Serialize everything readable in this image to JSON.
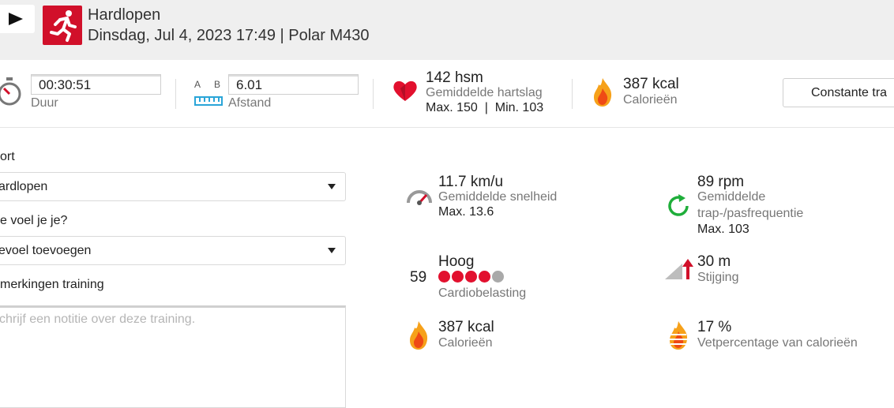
{
  "header": {
    "title": "Hardlopen",
    "subtitle": "Dinsdag, Jul 4, 2023 17:49 | Polar M430"
  },
  "stats": {
    "duration_value": "00:30:51",
    "duration_label": "Duur",
    "distance_ab_a": "A",
    "distance_ab_b": "B",
    "distance_value": "6.01",
    "distance_label": "Afstand",
    "hr_value": "142 hsm",
    "hr_label": "Gemiddelde hartslag",
    "hr_minmax": "Max. 150  |  Min. 103",
    "cal_value": "387 kcal",
    "cal_label": "Calorieën",
    "constant_button": "Constante tra"
  },
  "form": {
    "sport_label": "ort",
    "sport_value": "ardlopen",
    "feeling_label": "e voel je je?",
    "feeling_value": "evoel toevoegen",
    "notes_label": "merkingen training",
    "notes_placeholder": "chrijf een notitie over deze training."
  },
  "metrics": {
    "speed_value": "11.7 km/u",
    "speed_label": "Gemiddelde snelheid",
    "speed_max": "Max. 13.6",
    "cadence_value": "89 rpm",
    "cadence_label1": "Gemiddelde",
    "cadence_label2": "trap-/pasfrequentie",
    "cadence_max": "Max. 103",
    "load_number": "59",
    "load_value": "Hoog",
    "load_label": "Cardiobelasting",
    "load_dots_filled": 4,
    "load_dots_total": 5,
    "ascent_value": "30 m",
    "ascent_label": "Stijging",
    "cal_value": "387 kcal",
    "cal_label": "Calorieën",
    "fat_value": "17 %",
    "fat_label": "Vetpercentage van calorieën"
  },
  "colors": {
    "accent_red": "#d1102a",
    "dot_red": "#e2102e",
    "dot_grey": "#a9a9a9",
    "cadence_green": "#1fae3a",
    "distance_blue": "#2aa5d8"
  },
  "icons": [
    "play-icon",
    "running-icon",
    "stopwatch-icon",
    "ruler-icon",
    "heart-icon",
    "flame-icon",
    "speedometer-icon",
    "cadence-icon",
    "ascent-icon",
    "fat-flame-icon",
    "caret-down-icon"
  ]
}
